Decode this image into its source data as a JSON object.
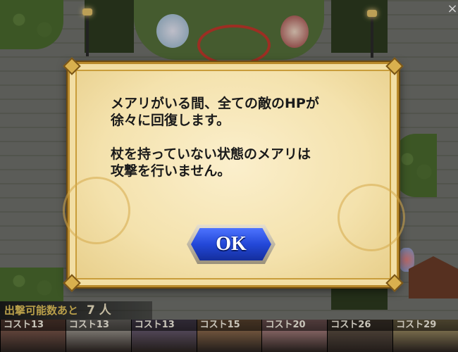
{
  "dialog": {
    "message": "メアリがいる間、全ての敵のHPが\n徐々に回復します。\n\n杖を持っていない状態のメアリは\n攻撃を行いません。",
    "ok_label": "OK"
  },
  "sortie": {
    "label": "出撃可能数あと",
    "count": "7 人"
  },
  "units": [
    {
      "cost": "コスト13",
      "color": "#9a6a5a"
    },
    {
      "cost": "コスト13",
      "color": "#c9c4bb"
    },
    {
      "cost": "コスト13",
      "color": "#7f6f8f"
    },
    {
      "cost": "コスト15",
      "color": "#b7895f"
    },
    {
      "cost": "コスト20",
      "color": "#d8a1a1"
    },
    {
      "cost": "コスト26",
      "color": "#6f5f4f"
    },
    {
      "cost": "コスト29",
      "color": "#c6b27a"
    }
  ],
  "close_icon": "×"
}
